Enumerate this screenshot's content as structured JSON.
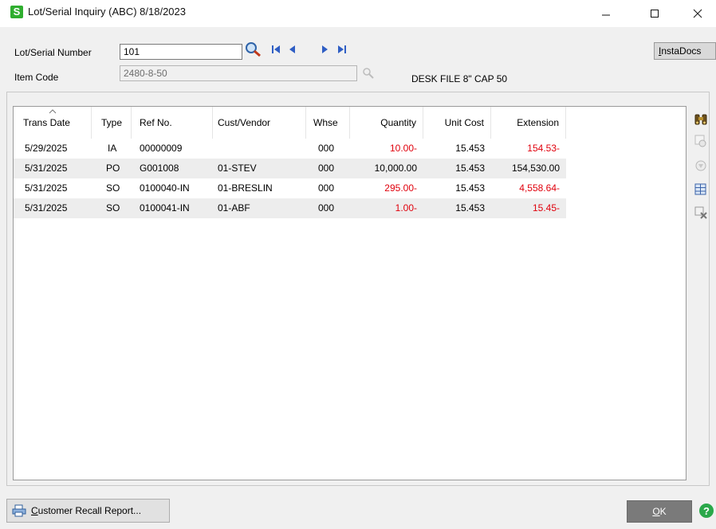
{
  "window": {
    "app_icon_letter": "S",
    "title": "Lot/Serial Inquiry (ABC) 8/18/2023"
  },
  "form": {
    "lot_label": "Lot/Serial Number",
    "lot_value": "101",
    "item_label": "Item Code",
    "item_value": "2480-8-50",
    "item_description": "DESK FILE 8\" CAP 50",
    "instadocs_first": "I",
    "instadocs_rest": "nstaDocs"
  },
  "grid": {
    "columns": [
      "Trans Date",
      "Type",
      "Ref No.",
      "Cust/Vendor",
      "Whse",
      "Quantity",
      "Unit Cost",
      "Extension"
    ],
    "rows": [
      {
        "date": "5/29/2025",
        "type": "IA",
        "ref": "00000009",
        "cust": "",
        "whse": "000",
        "qty": "10.00-",
        "cost": "15.453",
        "ext": "154.53-"
      },
      {
        "date": "5/31/2025",
        "type": "PO",
        "ref": "G001008",
        "cust": "01-STEV",
        "whse": "000",
        "qty": "10,000.00",
        "cost": "15.453",
        "ext": "154,530.00"
      },
      {
        "date": "5/31/2025",
        "type": "SO",
        "ref": "0100040-IN",
        "cust": "01-BRESLIN",
        "whse": "000",
        "qty": "295.00-",
        "cost": "15.453",
        "ext": "4,558.64-"
      },
      {
        "date": "5/31/2025",
        "type": "SO",
        "ref": "0100041-IN",
        "cust": "01-ABF",
        "whse": "000",
        "qty": "1.00-",
        "cost": "15.453",
        "ext": "15.45-"
      }
    ]
  },
  "footer": {
    "recall_first": "C",
    "recall_rest": "ustomer Recall Report...",
    "ok_first": "O",
    "ok_rest": "K"
  },
  "colors": {
    "negative": "#e0000c",
    "app_icon": "#2fae2f",
    "row_shade": "#ededed"
  }
}
